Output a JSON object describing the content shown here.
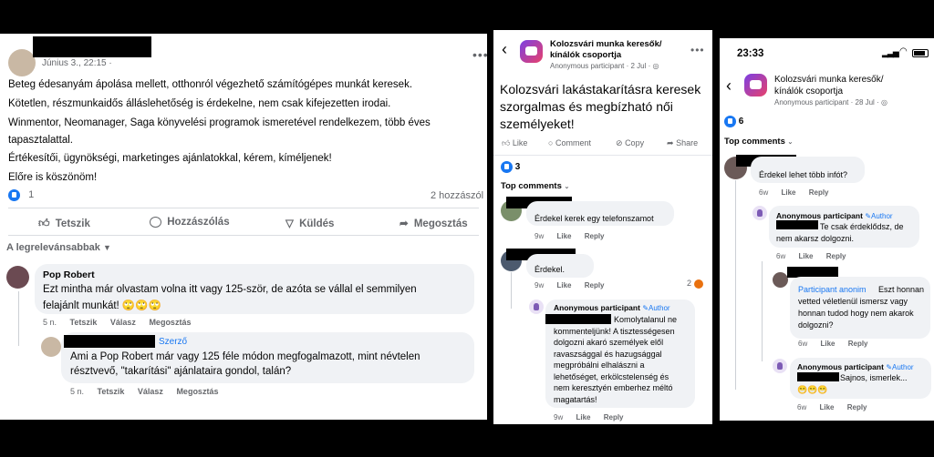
{
  "panel1": {
    "post_date": "Június 3., 22:15 ·",
    "lines": [
      "Beteg édesanyám ápolása mellett, otthonról végezhető számítógépes munkát keresek.",
      "Kötetlen, részmunkaidős álláslehetőség is érdekelne, nem csak kifejezetten irodai.",
      "Winmentor, Neomanager, Saga könyvelési programok ismeretével rendelkezem, több éves",
      "tapasztalattal.",
      "Értékesítői, ügynökségi, marketinges ajánlatokkal, kérem, kíméljenek!",
      "Előre is köszönöm!"
    ],
    "reaction_count": "1",
    "comment_count": "2 hozzászól",
    "actions": {
      "like": "Tetszik",
      "comment": "Hozzászólás",
      "send": "Küldés",
      "share": "Megosztás"
    },
    "sort_label": "A legrelevánsabbak",
    "comment1": {
      "author": "Pop Robert",
      "text1": "Ezt mintha már olvastam volna itt vagy 125-ször, de azóta se vállal el semmilyen",
      "text2": "felajánlt munkát! 🙄🙄🙄",
      "time": "5 n.",
      "like": "Tetszik",
      "reply": "Válasz",
      "share": "Megosztás"
    },
    "comment2": {
      "badge": "Szerző",
      "text1": "Ami a Pop Robert már vagy 125 féle módon megfogalmazott, mint névtelen",
      "text2": "résztvevő, \"takarítási\" ajánlataira gondol, talán?",
      "time": "5 n.",
      "like": "Tetszik",
      "reply": "Válasz",
      "share": "Megosztás"
    }
  },
  "panel2": {
    "group_name1": "Kolozsvári munka keresők/",
    "group_name2": "kínálók csoportja",
    "subline": "Anonymous participant · 2 Jul · ◎",
    "post_lines": [
      "Kolozsvári lakástakarításra keresek",
      "szorgalmas és megbízható női",
      "személyeket!"
    ],
    "actions": {
      "like": "Like",
      "comment": "Comment",
      "copy": "Copy",
      "share": "Share"
    },
    "reaction_count": "3",
    "top_comments": "Top comments",
    "c1": {
      "text": "Érdekel  kerek egy telefonszamot",
      "time": "9w",
      "like": "Like",
      "reply": "Reply"
    },
    "c2": {
      "text": "Érdekel.",
      "time": "9w",
      "like": "Like",
      "reply": "Reply",
      "reactions": "2"
    },
    "c3": {
      "author": "Anonymous participant",
      "badge": "Author",
      "lines": [
        "Komolytalanul ne",
        "kommenteljünk! A tisztességesen",
        "dolgozni akaró személyek elől",
        "ravaszsággal és hazugsággal",
        "megpróbálni elhalászni a",
        "lehetőséget, erkölcstelenség és",
        "nem keresztyén emberhez méltó",
        "magatartás!"
      ],
      "time": "9w",
      "like": "Like",
      "reply": "Reply"
    }
  },
  "panel3": {
    "clock": "23:33",
    "group_name1": "Kolozsvári munka keresők/",
    "group_name2": "kínálók csoportja",
    "subline": "Anonymous participant · 28 Jul · ◎",
    "reaction_count": "6",
    "top_comments": "Top comments",
    "c1": {
      "text": "Érdekel lehet több infót?",
      "time": "6w",
      "like": "Like",
      "reply": "Reply"
    },
    "c2": {
      "author": "Anonymous participant",
      "badge": "Author",
      "lines": [
        "Te csak érdeklődsz, de",
        "nem akarsz dolgozni."
      ],
      "time": "6w",
      "like": "Like",
      "reply": "Reply"
    },
    "c3": {
      "author": "Participant anonim",
      "lines": [
        "Eszt honnan",
        "vetted véletlenül ismersz vagy",
        "honnan tudod hogy nem akarok",
        "dolgozni?"
      ],
      "time": "6w",
      "like": "Like",
      "reply": "Reply"
    },
    "c4": {
      "author": "Anonymous participant",
      "badge": "Author",
      "lines": [
        "Sajnos, ismerlek...",
        "😁😁😁"
      ],
      "time": "6w",
      "like": "Like",
      "reply": "Reply"
    }
  }
}
